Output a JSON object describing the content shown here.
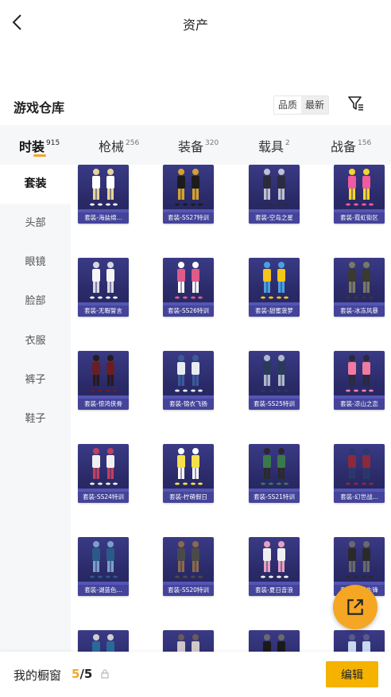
{
  "header": {
    "title": "资产",
    "back_icon": "back-icon"
  },
  "warehouse": {
    "title": "游戏仓库",
    "sort_options": [
      {
        "label": "品质",
        "active": false
      },
      {
        "label": "最新",
        "active": true
      }
    ],
    "filter_icon": "filter-icon"
  },
  "tabs": [
    {
      "label": "时装",
      "count": "915",
      "active": true
    },
    {
      "label": "枪械",
      "count": "256",
      "active": false
    },
    {
      "label": "装备",
      "count": "320",
      "active": false
    },
    {
      "label": "载具",
      "count": "2",
      "active": false
    },
    {
      "label": "战备",
      "count": "156",
      "active": false
    }
  ],
  "sidebar": {
    "items": [
      {
        "label": "套装",
        "active": true
      },
      {
        "label": "头部",
        "active": false
      },
      {
        "label": "眼镜",
        "active": false
      },
      {
        "label": "脸部",
        "active": false
      },
      {
        "label": "衣服",
        "active": false
      },
      {
        "label": "裤子",
        "active": false
      },
      {
        "label": "鞋子",
        "active": false
      }
    ]
  },
  "items": [
    {
      "label": "套装-海盐绵...",
      "colors": [
        "#ffffff",
        "#e8d39a"
      ]
    },
    {
      "label": "套装-SS27特训",
      "colors": [
        "#1c1c1c",
        "#d4a22b"
      ]
    },
    {
      "label": "套装-空岛之星",
      "colors": [
        "#2b2b40",
        "#c0c0d0"
      ]
    },
    {
      "label": "套装-霓虹街区",
      "colors": [
        "#f05aa0",
        "#f6d52b"
      ]
    },
    {
      "label": "套装-无暇誓言",
      "colors": [
        "#f5f5f5",
        "#d8d8e0"
      ]
    },
    {
      "label": "套装-SS26特训",
      "colors": [
        "#e05a8a",
        "#ffffff"
      ]
    },
    {
      "label": "套装-甜蜜菠萝",
      "colors": [
        "#f5c518",
        "#4aa0e0"
      ]
    },
    {
      "label": "套装-冰冻风暴",
      "colors": [
        "#3a3a2e",
        "#7a7a60"
      ]
    },
    {
      "label": "套装-惊鸿侠骨",
      "colors": [
        "#6a1e24",
        "#2a1a1a"
      ]
    },
    {
      "label": "套装-锦衣飞扬",
      "colors": [
        "#e8ecf2",
        "#3a5a9a"
      ]
    },
    {
      "label": "套装-SS25特训",
      "colors": [
        "#2a3a5a",
        "#b0b8c8"
      ]
    },
    {
      "label": "套装-凉山之恋",
      "colors": [
        "#f07aa0",
        "#2a2a3a"
      ]
    },
    {
      "label": "套装-SS24特训",
      "colors": [
        "#f0f0f0",
        "#c04060"
      ]
    },
    {
      "label": "套装-柠萌假日",
      "colors": [
        "#f5e04a",
        "#ffffff"
      ]
    },
    {
      "label": "套装-SS21特训",
      "colors": [
        "#3a7a4a",
        "#2a2a2a"
      ]
    },
    {
      "label": "套装-幻世战...",
      "colors": [
        "#8a2a3a",
        "#2a3a6a"
      ]
    },
    {
      "label": "套装-湖蓝色...",
      "colors": [
        "#2a5a8a",
        "#7aa0c8"
      ]
    },
    {
      "label": "套装-SS20特训",
      "colors": [
        "#4a4a4a",
        "#8a6a4a"
      ]
    },
    {
      "label": "套装-夏日音浪",
      "colors": [
        "#f0f0f0",
        "#e8a0c0"
      ]
    },
    {
      "label": "套装-风暴先锋",
      "colors": [
        "#2a2a2a",
        "#6a6a6a"
      ]
    },
    {
      "label": "",
      "colors": [
        "#2a6a9a",
        "#d0d0d0"
      ]
    },
    {
      "label": "",
      "colors": [
        "#d0c8c8",
        "#6a5a5a"
      ]
    },
    {
      "label": "",
      "colors": [
        "#1a1a1a",
        "#6a6a6a"
      ]
    },
    {
      "label": "",
      "colors": [
        "#c8d8f0",
        "#5a5a8a"
      ]
    }
  ],
  "fab": {
    "icon": "share-icon"
  },
  "bottom_bar": {
    "label": "我的橱窗",
    "count_current": "5",
    "count_separator": "/",
    "count_total": "5",
    "lock_icon": "lock-icon",
    "edit_label": "编辑"
  },
  "colors": {
    "accent": "#f5a623",
    "card_bg": "#2e2e70",
    "sidebar_bg": "#f6f7f9"
  }
}
